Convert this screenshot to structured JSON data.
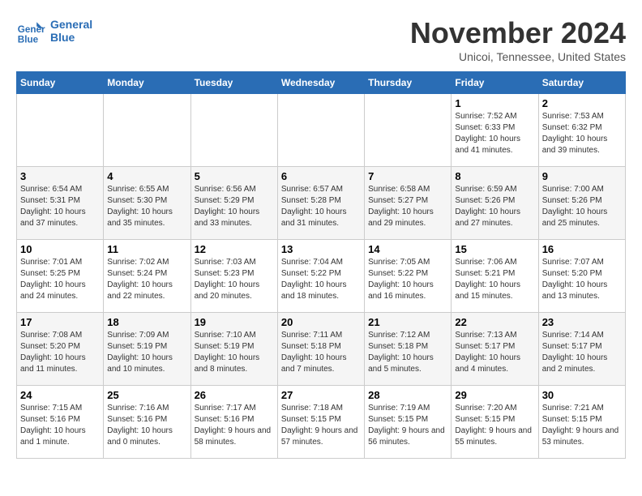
{
  "header": {
    "logo_line1": "General",
    "logo_line2": "Blue",
    "month": "November 2024",
    "location": "Unicoi, Tennessee, United States"
  },
  "weekdays": [
    "Sunday",
    "Monday",
    "Tuesday",
    "Wednesday",
    "Thursday",
    "Friday",
    "Saturday"
  ],
  "weeks": [
    [
      {
        "day": "",
        "info": ""
      },
      {
        "day": "",
        "info": ""
      },
      {
        "day": "",
        "info": ""
      },
      {
        "day": "",
        "info": ""
      },
      {
        "day": "",
        "info": ""
      },
      {
        "day": "1",
        "info": "Sunrise: 7:52 AM\nSunset: 6:33 PM\nDaylight: 10 hours and 41 minutes."
      },
      {
        "day": "2",
        "info": "Sunrise: 7:53 AM\nSunset: 6:32 PM\nDaylight: 10 hours and 39 minutes."
      }
    ],
    [
      {
        "day": "3",
        "info": "Sunrise: 6:54 AM\nSunset: 5:31 PM\nDaylight: 10 hours and 37 minutes."
      },
      {
        "day": "4",
        "info": "Sunrise: 6:55 AM\nSunset: 5:30 PM\nDaylight: 10 hours and 35 minutes."
      },
      {
        "day": "5",
        "info": "Sunrise: 6:56 AM\nSunset: 5:29 PM\nDaylight: 10 hours and 33 minutes."
      },
      {
        "day": "6",
        "info": "Sunrise: 6:57 AM\nSunset: 5:28 PM\nDaylight: 10 hours and 31 minutes."
      },
      {
        "day": "7",
        "info": "Sunrise: 6:58 AM\nSunset: 5:27 PM\nDaylight: 10 hours and 29 minutes."
      },
      {
        "day": "8",
        "info": "Sunrise: 6:59 AM\nSunset: 5:26 PM\nDaylight: 10 hours and 27 minutes."
      },
      {
        "day": "9",
        "info": "Sunrise: 7:00 AM\nSunset: 5:26 PM\nDaylight: 10 hours and 25 minutes."
      }
    ],
    [
      {
        "day": "10",
        "info": "Sunrise: 7:01 AM\nSunset: 5:25 PM\nDaylight: 10 hours and 24 minutes."
      },
      {
        "day": "11",
        "info": "Sunrise: 7:02 AM\nSunset: 5:24 PM\nDaylight: 10 hours and 22 minutes."
      },
      {
        "day": "12",
        "info": "Sunrise: 7:03 AM\nSunset: 5:23 PM\nDaylight: 10 hours and 20 minutes."
      },
      {
        "day": "13",
        "info": "Sunrise: 7:04 AM\nSunset: 5:22 PM\nDaylight: 10 hours and 18 minutes."
      },
      {
        "day": "14",
        "info": "Sunrise: 7:05 AM\nSunset: 5:22 PM\nDaylight: 10 hours and 16 minutes."
      },
      {
        "day": "15",
        "info": "Sunrise: 7:06 AM\nSunset: 5:21 PM\nDaylight: 10 hours and 15 minutes."
      },
      {
        "day": "16",
        "info": "Sunrise: 7:07 AM\nSunset: 5:20 PM\nDaylight: 10 hours and 13 minutes."
      }
    ],
    [
      {
        "day": "17",
        "info": "Sunrise: 7:08 AM\nSunset: 5:20 PM\nDaylight: 10 hours and 11 minutes."
      },
      {
        "day": "18",
        "info": "Sunrise: 7:09 AM\nSunset: 5:19 PM\nDaylight: 10 hours and 10 minutes."
      },
      {
        "day": "19",
        "info": "Sunrise: 7:10 AM\nSunset: 5:19 PM\nDaylight: 10 hours and 8 minutes."
      },
      {
        "day": "20",
        "info": "Sunrise: 7:11 AM\nSunset: 5:18 PM\nDaylight: 10 hours and 7 minutes."
      },
      {
        "day": "21",
        "info": "Sunrise: 7:12 AM\nSunset: 5:18 PM\nDaylight: 10 hours and 5 minutes."
      },
      {
        "day": "22",
        "info": "Sunrise: 7:13 AM\nSunset: 5:17 PM\nDaylight: 10 hours and 4 minutes."
      },
      {
        "day": "23",
        "info": "Sunrise: 7:14 AM\nSunset: 5:17 PM\nDaylight: 10 hours and 2 minutes."
      }
    ],
    [
      {
        "day": "24",
        "info": "Sunrise: 7:15 AM\nSunset: 5:16 PM\nDaylight: 10 hours and 1 minute."
      },
      {
        "day": "25",
        "info": "Sunrise: 7:16 AM\nSunset: 5:16 PM\nDaylight: 10 hours and 0 minutes."
      },
      {
        "day": "26",
        "info": "Sunrise: 7:17 AM\nSunset: 5:16 PM\nDaylight: 9 hours and 58 minutes."
      },
      {
        "day": "27",
        "info": "Sunrise: 7:18 AM\nSunset: 5:15 PM\nDaylight: 9 hours and 57 minutes."
      },
      {
        "day": "28",
        "info": "Sunrise: 7:19 AM\nSunset: 5:15 PM\nDaylight: 9 hours and 56 minutes."
      },
      {
        "day": "29",
        "info": "Sunrise: 7:20 AM\nSunset: 5:15 PM\nDaylight: 9 hours and 55 minutes."
      },
      {
        "day": "30",
        "info": "Sunrise: 7:21 AM\nSunset: 5:15 PM\nDaylight: 9 hours and 53 minutes."
      }
    ]
  ]
}
